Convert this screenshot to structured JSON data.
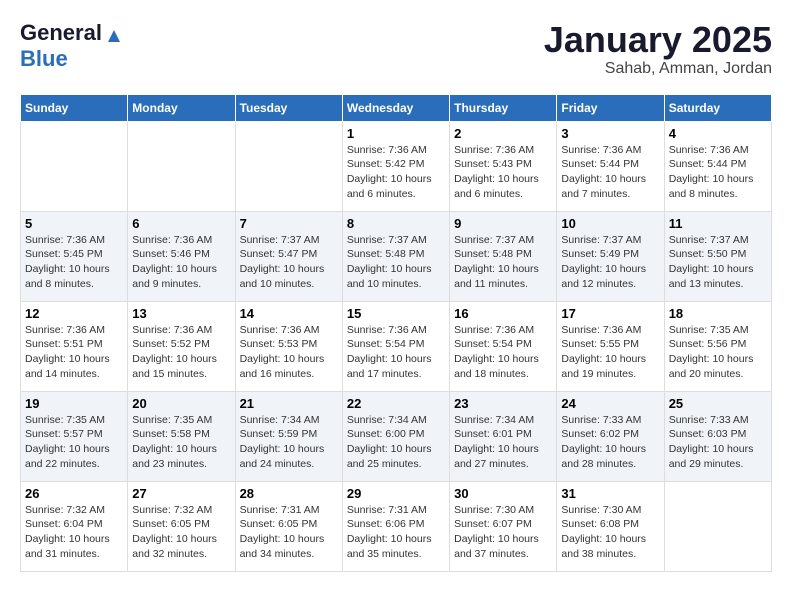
{
  "header": {
    "logo_general": "General",
    "logo_blue": "Blue",
    "title": "January 2025",
    "subtitle": "Sahab, Amman, Jordan"
  },
  "weekdays": [
    "Sunday",
    "Monday",
    "Tuesday",
    "Wednesday",
    "Thursday",
    "Friday",
    "Saturday"
  ],
  "weeks": [
    [
      {
        "day": "",
        "info": ""
      },
      {
        "day": "",
        "info": ""
      },
      {
        "day": "",
        "info": ""
      },
      {
        "day": "1",
        "info": "Sunrise: 7:36 AM\nSunset: 5:42 PM\nDaylight: 10 hours\nand 6 minutes."
      },
      {
        "day": "2",
        "info": "Sunrise: 7:36 AM\nSunset: 5:43 PM\nDaylight: 10 hours\nand 6 minutes."
      },
      {
        "day": "3",
        "info": "Sunrise: 7:36 AM\nSunset: 5:44 PM\nDaylight: 10 hours\nand 7 minutes."
      },
      {
        "day": "4",
        "info": "Sunrise: 7:36 AM\nSunset: 5:44 PM\nDaylight: 10 hours\nand 8 minutes."
      }
    ],
    [
      {
        "day": "5",
        "info": "Sunrise: 7:36 AM\nSunset: 5:45 PM\nDaylight: 10 hours\nand 8 minutes."
      },
      {
        "day": "6",
        "info": "Sunrise: 7:36 AM\nSunset: 5:46 PM\nDaylight: 10 hours\nand 9 minutes."
      },
      {
        "day": "7",
        "info": "Sunrise: 7:37 AM\nSunset: 5:47 PM\nDaylight: 10 hours\nand 10 minutes."
      },
      {
        "day": "8",
        "info": "Sunrise: 7:37 AM\nSunset: 5:48 PM\nDaylight: 10 hours\nand 10 minutes."
      },
      {
        "day": "9",
        "info": "Sunrise: 7:37 AM\nSunset: 5:48 PM\nDaylight: 10 hours\nand 11 minutes."
      },
      {
        "day": "10",
        "info": "Sunrise: 7:37 AM\nSunset: 5:49 PM\nDaylight: 10 hours\nand 12 minutes."
      },
      {
        "day": "11",
        "info": "Sunrise: 7:37 AM\nSunset: 5:50 PM\nDaylight: 10 hours\nand 13 minutes."
      }
    ],
    [
      {
        "day": "12",
        "info": "Sunrise: 7:36 AM\nSunset: 5:51 PM\nDaylight: 10 hours\nand 14 minutes."
      },
      {
        "day": "13",
        "info": "Sunrise: 7:36 AM\nSunset: 5:52 PM\nDaylight: 10 hours\nand 15 minutes."
      },
      {
        "day": "14",
        "info": "Sunrise: 7:36 AM\nSunset: 5:53 PM\nDaylight: 10 hours\nand 16 minutes."
      },
      {
        "day": "15",
        "info": "Sunrise: 7:36 AM\nSunset: 5:54 PM\nDaylight: 10 hours\nand 17 minutes."
      },
      {
        "day": "16",
        "info": "Sunrise: 7:36 AM\nSunset: 5:54 PM\nDaylight: 10 hours\nand 18 minutes."
      },
      {
        "day": "17",
        "info": "Sunrise: 7:36 AM\nSunset: 5:55 PM\nDaylight: 10 hours\nand 19 minutes."
      },
      {
        "day": "18",
        "info": "Sunrise: 7:35 AM\nSunset: 5:56 PM\nDaylight: 10 hours\nand 20 minutes."
      }
    ],
    [
      {
        "day": "19",
        "info": "Sunrise: 7:35 AM\nSunset: 5:57 PM\nDaylight: 10 hours\nand 22 minutes."
      },
      {
        "day": "20",
        "info": "Sunrise: 7:35 AM\nSunset: 5:58 PM\nDaylight: 10 hours\nand 23 minutes."
      },
      {
        "day": "21",
        "info": "Sunrise: 7:34 AM\nSunset: 5:59 PM\nDaylight: 10 hours\nand 24 minutes."
      },
      {
        "day": "22",
        "info": "Sunrise: 7:34 AM\nSunset: 6:00 PM\nDaylight: 10 hours\nand 25 minutes."
      },
      {
        "day": "23",
        "info": "Sunrise: 7:34 AM\nSunset: 6:01 PM\nDaylight: 10 hours\nand 27 minutes."
      },
      {
        "day": "24",
        "info": "Sunrise: 7:33 AM\nSunset: 6:02 PM\nDaylight: 10 hours\nand 28 minutes."
      },
      {
        "day": "25",
        "info": "Sunrise: 7:33 AM\nSunset: 6:03 PM\nDaylight: 10 hours\nand 29 minutes."
      }
    ],
    [
      {
        "day": "26",
        "info": "Sunrise: 7:32 AM\nSunset: 6:04 PM\nDaylight: 10 hours\nand 31 minutes."
      },
      {
        "day": "27",
        "info": "Sunrise: 7:32 AM\nSunset: 6:05 PM\nDaylight: 10 hours\nand 32 minutes."
      },
      {
        "day": "28",
        "info": "Sunrise: 7:31 AM\nSunset: 6:05 PM\nDaylight: 10 hours\nand 34 minutes."
      },
      {
        "day": "29",
        "info": "Sunrise: 7:31 AM\nSunset: 6:06 PM\nDaylight: 10 hours\nand 35 minutes."
      },
      {
        "day": "30",
        "info": "Sunrise: 7:30 AM\nSunset: 6:07 PM\nDaylight: 10 hours\nand 37 minutes."
      },
      {
        "day": "31",
        "info": "Sunrise: 7:30 AM\nSunset: 6:08 PM\nDaylight: 10 hours\nand 38 minutes."
      },
      {
        "day": "",
        "info": ""
      }
    ]
  ]
}
